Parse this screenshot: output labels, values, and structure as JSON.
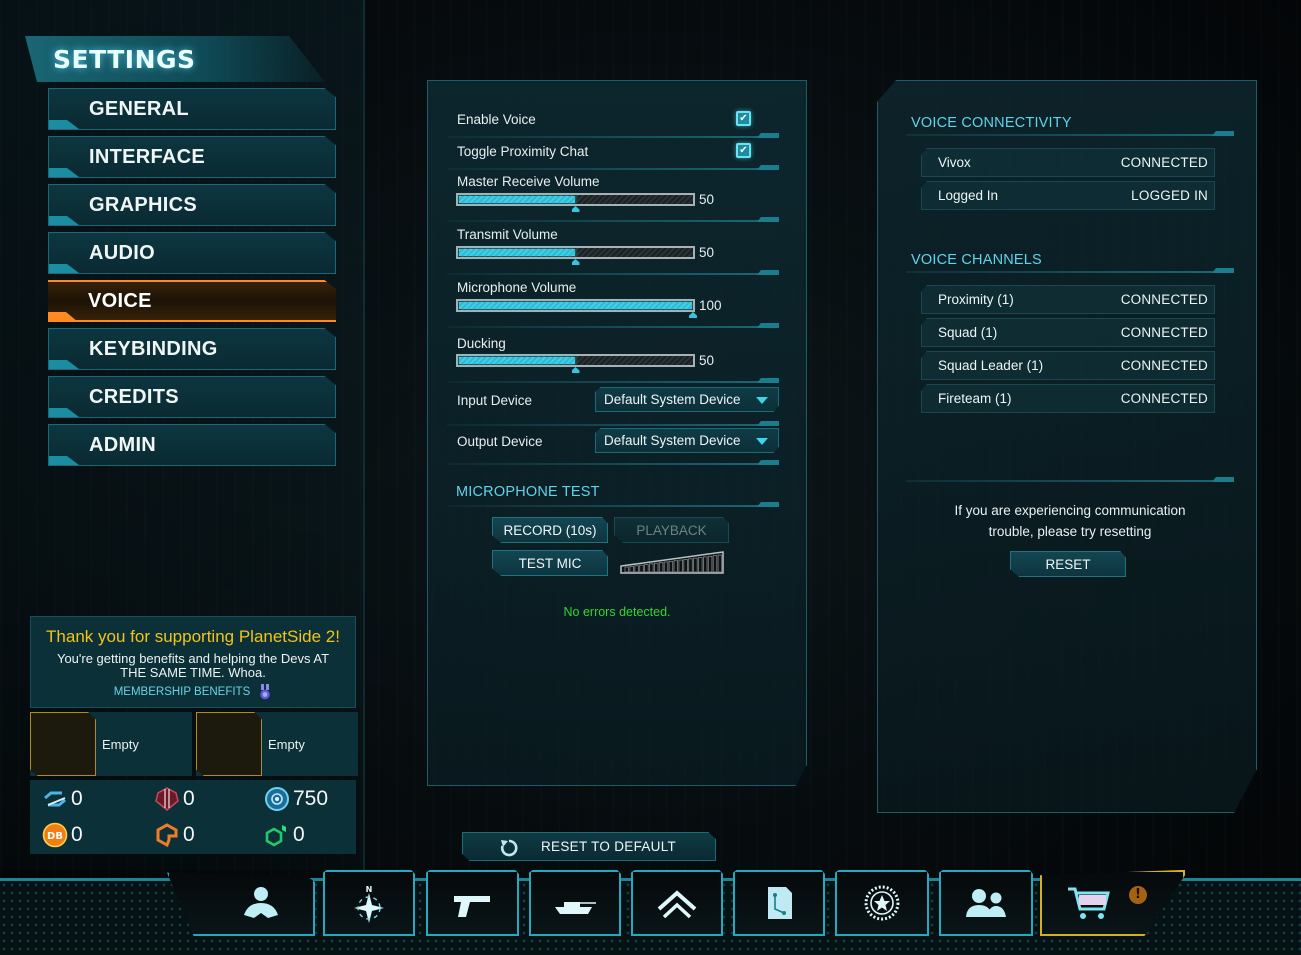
{
  "sidebar": {
    "title": "SETTINGS",
    "items": [
      {
        "label": "GENERAL",
        "active": false
      },
      {
        "label": "INTERFACE",
        "active": false
      },
      {
        "label": "GRAPHICS",
        "active": false
      },
      {
        "label": "AUDIO",
        "active": false
      },
      {
        "label": "VOICE",
        "active": true
      },
      {
        "label": "KEYBINDING",
        "active": false
      },
      {
        "label": "CREDITS",
        "active": false
      },
      {
        "label": "ADMIN",
        "active": false
      }
    ]
  },
  "membership": {
    "title": "Thank you for supporting PlanetSide 2!",
    "text": "You're getting benefits and helping the Devs AT THE SAME TIME. Whoa.",
    "link": "MEMBERSHIP BENEFITS",
    "boosts": [
      {
        "label": "Empty"
      },
      {
        "label": "Empty"
      }
    ]
  },
  "currencies": [
    {
      "icon": "certs-icon",
      "value": "0"
    },
    {
      "icon": "implant-icon",
      "value": "0"
    },
    {
      "icon": "nanite-icon",
      "value": "750"
    },
    {
      "icon": "daybreak-cash-icon",
      "value": "0"
    },
    {
      "icon": "ascension-icon",
      "value": "0"
    },
    {
      "icon": "polystellarite-icon",
      "value": "0"
    }
  ],
  "voice": {
    "toggles": [
      {
        "label": "Enable Voice",
        "checked": true
      },
      {
        "label": "Toggle Proximity Chat",
        "checked": true
      }
    ],
    "sliders": [
      {
        "label": "Master Receive Volume",
        "value": 50,
        "display": "50"
      },
      {
        "label": "Transmit Volume",
        "value": 50,
        "display": "50"
      },
      {
        "label": "Microphone Volume",
        "value": 100,
        "display": "100"
      },
      {
        "label": "Ducking",
        "value": 50,
        "display": "50"
      }
    ],
    "devices": [
      {
        "label": "Input Device",
        "value": "Default System Device"
      },
      {
        "label": "Output Device",
        "value": "Default System Device"
      }
    ],
    "mic_test": {
      "header": "MICROPHONE TEST",
      "record_label": "RECORD (10s)",
      "playback_label": "PLAYBACK",
      "playback_enabled": false,
      "test_mic_label": "TEST MIC",
      "mic_level": 0,
      "status": "No errors detected."
    },
    "reset_default_label": "RESET TO DEFAULT"
  },
  "connectivity": {
    "header": "VOICE CONNECTIVITY",
    "rows": [
      {
        "name": "Vivox",
        "status": "CONNECTED"
      },
      {
        "name": "Logged In",
        "status": "LOGGED IN"
      }
    ]
  },
  "channels": {
    "header": "VOICE CHANNELS",
    "rows": [
      {
        "name": "Proximity (1)",
        "status": "CONNECTED"
      },
      {
        "name": "Squad (1)",
        "status": "CONNECTED"
      },
      {
        "name": "Squad Leader (1)",
        "status": "CONNECTED"
      },
      {
        "name": "Fireteam (1)",
        "status": "CONNECTED"
      }
    ]
  },
  "reset": {
    "message": "If you are experiencing communication trouble, please try resetting",
    "button_label": "RESET"
  },
  "bottom_tabs": [
    {
      "name": "character"
    },
    {
      "name": "map"
    },
    {
      "name": "weapons"
    },
    {
      "name": "vehicles"
    },
    {
      "name": "ranks"
    },
    {
      "name": "directives"
    },
    {
      "name": "achievements"
    },
    {
      "name": "social"
    },
    {
      "name": "depot-store",
      "alert": "!"
    }
  ],
  "colors": {
    "accent": "#3fd0e8",
    "active_nav": "#ff8a1f",
    "member_title": "#f2c418",
    "ok_status": "#32d632",
    "store_border": "#d4b21c"
  }
}
